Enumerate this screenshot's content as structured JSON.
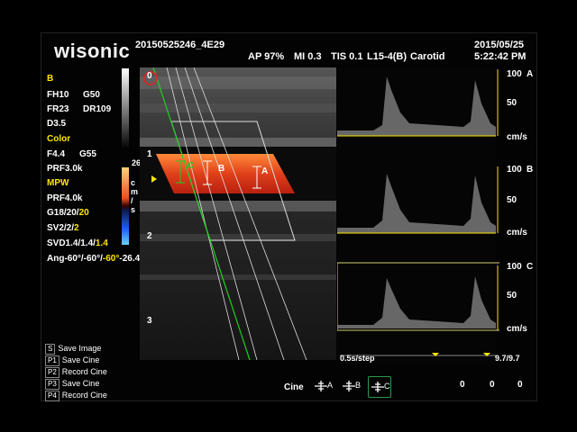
{
  "brand": "wisonic",
  "header": {
    "study_id": "20150525246_4E29",
    "ap": "AP 97%",
    "mi": "MI 0.3",
    "tis": "TIS 0.1",
    "probe": "L15-4(B)",
    "preset": "Carotid",
    "date": "2015/05/25",
    "time": "5:22:42 PM"
  },
  "params": {
    "b_title": "B",
    "fh": "FH10",
    "g": "G50",
    "fr": "FR23",
    "dr": "DR109",
    "d": "D3.5",
    "color_title": "Color",
    "f_color": "F4.4",
    "g_color": "G55",
    "prf_color": "PRF3.0k",
    "mpw_title": "MPW",
    "prf_pw": "PRF4.0k",
    "g_pw_prefix": "G18/20/",
    "g_pw_active": "20",
    "sv_prefix": "SV2/2/",
    "sv_active": "2",
    "svd_prefix": "SVD1.4/1.4/",
    "svd_active": "1.4",
    "ang_prefix": "Ang-60°/-60°/",
    "ang_active": "-60°",
    "ang_suffix": "-26.4"
  },
  "color_bar": {
    "top_value": "26.4",
    "unit_c": "c",
    "unit_m": "m",
    "unit_slash": "/",
    "unit_s": "s"
  },
  "depth_marks": [
    "0",
    "1",
    "2",
    "3"
  ],
  "gates": [
    "A",
    "B",
    "C"
  ],
  "doppler": {
    "panels": [
      {
        "label": "A",
        "s100": "100",
        "s50": "50",
        "unit": "cm/s"
      },
      {
        "label": "B",
        "s100": "100",
        "s50": "50",
        "unit": "cm/s"
      },
      {
        "label": "C",
        "s100": "100",
        "s50": "50",
        "unit": "cm/s"
      }
    ],
    "step": "0.5s/step",
    "ratio": "9.7/9.7"
  },
  "menu": [
    {
      "key": "S",
      "label": "Save Image"
    },
    {
      "key": "P1",
      "label": "Save Cine"
    },
    {
      "key": "P2",
      "label": "Record Cine"
    },
    {
      "key": "P3",
      "label": "Save Cine"
    },
    {
      "key": "P4",
      "label": "Record Cine"
    }
  ],
  "cine": {
    "label": "Cine",
    "buttons": [
      "A",
      "B",
      "C"
    ],
    "selected": "C",
    "counters": [
      "0",
      "0",
      "0"
    ]
  },
  "colors": {
    "accent_yellow": "#ffe600",
    "gate_green": "#22cc22",
    "flow_red": "#e8501a"
  }
}
